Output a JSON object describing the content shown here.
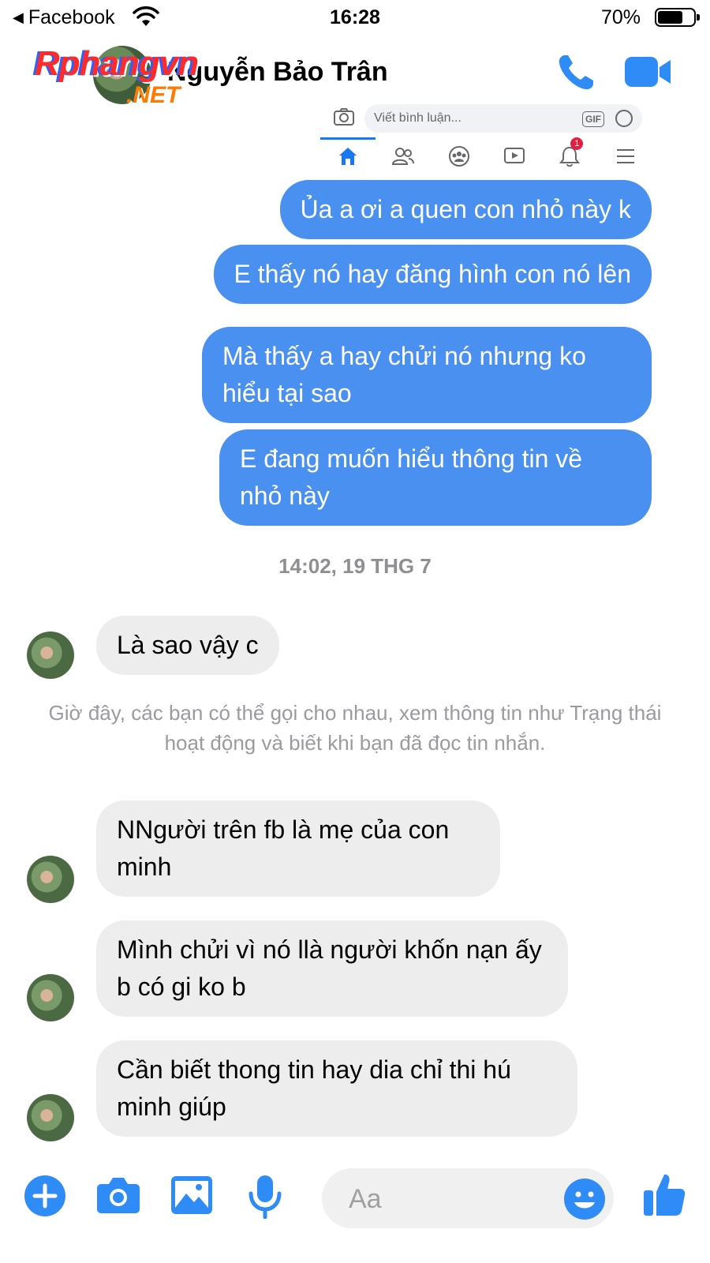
{
  "status_bar": {
    "back_label": "Facebook",
    "time": "16:28",
    "battery": "70%"
  },
  "header": {
    "contact_name": "Nguyễn Bảo Trân",
    "watermark_main": "Rphangvn",
    "watermark_sub": ".NET"
  },
  "shared_screenshot": {
    "comment_placeholder": "Viết bình luận...",
    "gif_label": "GIF",
    "notification_count": "1"
  },
  "messages": {
    "out_1": "Ủa a ơi a quen con nhỏ này k",
    "out_2": "E thấy nó hay đăng hình con nó lên",
    "out_3": "Mà thấy a hay chửi nó nhưng ko hiểu tại sao",
    "out_4": "E đang muốn hiểu thông tin về nhỏ này",
    "timestamp": "14:02, 19 THG 7",
    "in_1": "Là  sao vậy  c",
    "notice": "Giờ đây, các bạn có thể gọi cho nhau, xem thông tin như Trạng thái hoạt động và biết khi bạn đã đọc tin nhắn.",
    "in_2": "NNgười trên  fb là  mẹ  của con minh",
    "in_3": "Mình  chửi  vì  nó  llà người  khốn nạn ấy  b có  gi ko b",
    "in_4": "Cần biết  thong tin hay dia chỉ  thi hú minh giúp"
  },
  "composer": {
    "placeholder": "Aa"
  },
  "colors": {
    "accent": "#0084ff",
    "outgoing_bubble": "#4a90f0",
    "incoming_bubble": "#ededed"
  }
}
